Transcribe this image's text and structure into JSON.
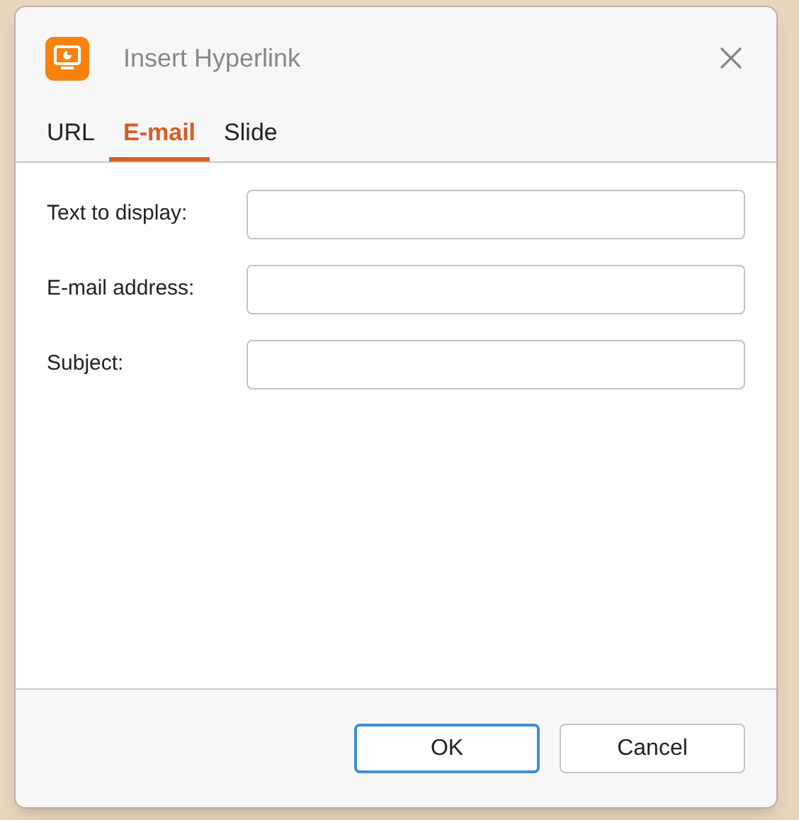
{
  "window": {
    "title": "Insert Hyperlink"
  },
  "tabs": [
    {
      "label": "URL",
      "selected": false
    },
    {
      "label": "E-mail",
      "selected": true
    },
    {
      "label": "Slide",
      "selected": false
    }
  ],
  "fields": [
    {
      "label": "Text to display:"
    },
    {
      "label": "E-mail address:"
    },
    {
      "label": "Subject:"
    }
  ],
  "buttons": [
    {
      "label": "OK",
      "kind": "primary"
    },
    {
      "label": "Cancel",
      "kind": "secondary"
    }
  ]
}
